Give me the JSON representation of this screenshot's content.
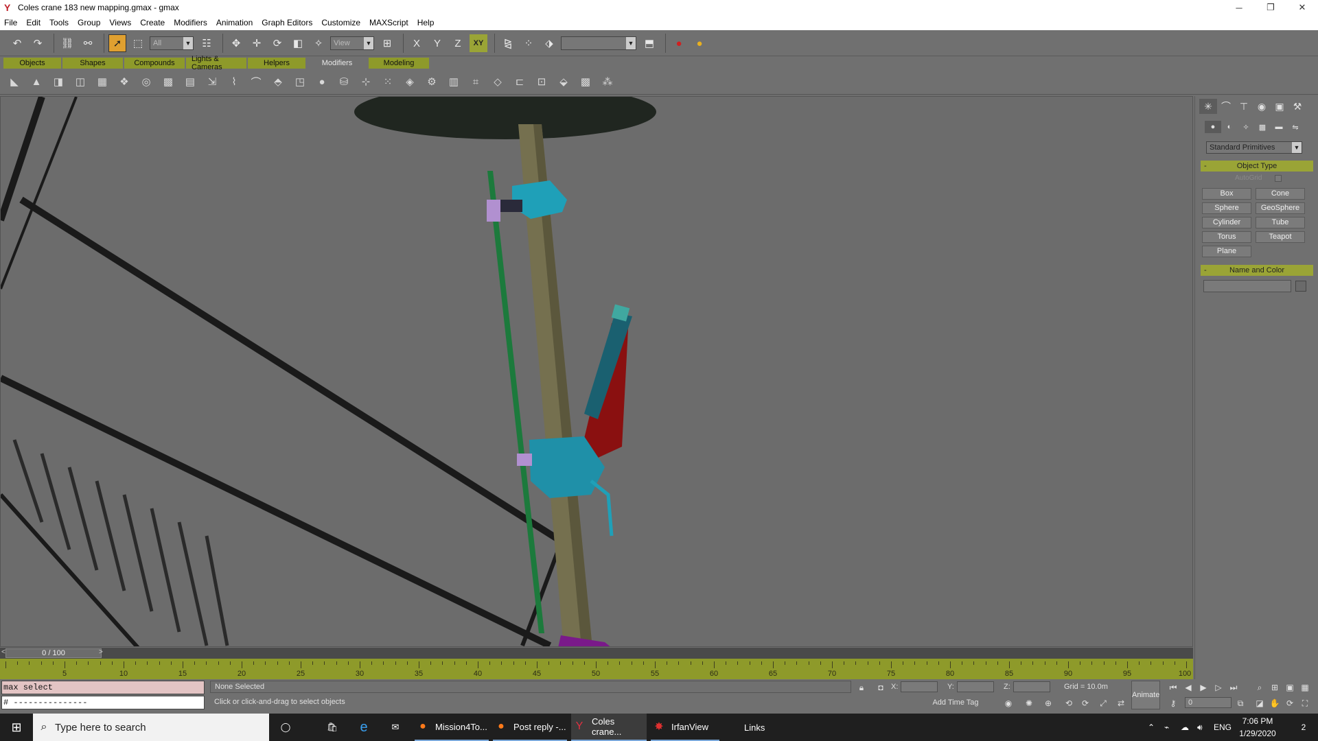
{
  "window": {
    "title": "Coles crane 183 new mapping.gmax - gmax",
    "controls": [
      "─",
      "❐",
      "✕"
    ]
  },
  "menu": [
    "File",
    "Edit",
    "Tools",
    "Group",
    "Views",
    "Create",
    "Modifiers",
    "Animation",
    "Graph Editors",
    "Customize",
    "MAXScript",
    "Help"
  ],
  "toolbar": {
    "selection_filter": "All",
    "ref_coord": "View",
    "axis_x": "X",
    "axis_y": "Y",
    "axis_z": "Z",
    "axis_xy": "XY",
    "named_selection": ""
  },
  "tabs": [
    {
      "label": "Objects",
      "selected": false
    },
    {
      "label": "Shapes",
      "selected": false
    },
    {
      "label": "Compounds",
      "selected": false
    },
    {
      "label": "Lights & Cameras",
      "selected": false
    },
    {
      "label": "Helpers",
      "selected": false
    },
    {
      "label": "Modifiers",
      "selected": true
    },
    {
      "label": "Modeling",
      "selected": false
    }
  ],
  "command_panel": {
    "category_dropdown": "Standard Primitives",
    "object_type_title": "Object Type",
    "autogrid_label": "AutoGrid",
    "primitives": [
      "Box",
      "Cone",
      "Sphere",
      "GeoSphere",
      "Cylinder",
      "Tube",
      "Torus",
      "Teapot",
      "Plane"
    ],
    "name_color_title": "Name and Color",
    "rollout_toggle": "-"
  },
  "timeline": {
    "frame_display": "0 / 100",
    "prev_arrow": "<",
    "next_arrow": ">",
    "ticks": [
      5,
      10,
      15,
      20,
      25,
      30,
      35,
      40,
      45,
      50,
      55,
      60,
      65,
      70,
      75,
      80,
      85,
      90,
      95,
      100
    ]
  },
  "status": {
    "maxscript_line1": "max select",
    "maxscript_line2": "# ---------------",
    "selection": "None Selected",
    "prompt": "Click or click-and-drag to select objects",
    "coord_x_label": "X:",
    "coord_y_label": "Y:",
    "coord_z_label": "Z:",
    "grid": "Grid = 10.0m",
    "add_time_tag": "Add Time Tag",
    "animate": "Animate",
    "current_frame": "0"
  },
  "taskbar": {
    "search_placeholder": "Type here to search",
    "apps": [
      {
        "label": "Mission4To...",
        "icon": "firefox-icon"
      },
      {
        "label": "Post reply -...",
        "icon": "firefox-icon"
      },
      {
        "label": "Coles crane...",
        "icon": "gmax-icon"
      },
      {
        "label": "IrfanView",
        "icon": "irfanview-icon"
      }
    ],
    "links": "Links",
    "language": "ENG",
    "time": "7:06 PM",
    "date": "1/29/2020",
    "notifications": "2"
  }
}
